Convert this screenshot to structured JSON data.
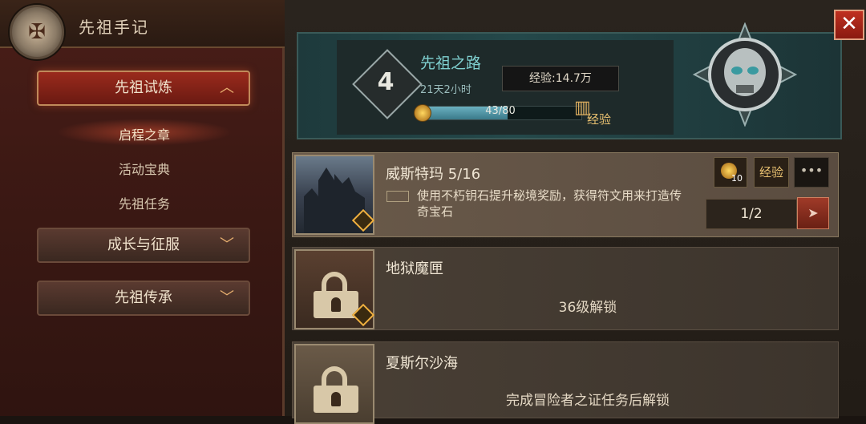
{
  "header": {
    "title": "先祖手记",
    "crest_icon": "sigil-icon"
  },
  "sidebar": {
    "menus": [
      {
        "label": "先祖试炼",
        "state": "expanded"
      },
      {
        "label": "成长与征服",
        "state": "collapsed"
      },
      {
        "label": "先祖传承",
        "state": "collapsed"
      }
    ],
    "sub_items": [
      "启程之章",
      "活动宝典",
      "先祖任务"
    ],
    "active_sub": "启程之章"
  },
  "banner": {
    "level": "4",
    "title": "先祖之路",
    "time_left": "21天2小时",
    "exp_total": "经验:14.7万",
    "exp_progress": "43/80",
    "exp_progress_fraction": 0.54,
    "exp_label": "经验"
  },
  "close": {
    "glyph": "✕"
  },
  "cards": [
    {
      "title": "威斯特玛 5/16",
      "description": "使用不朽钥石提升秘境奖励，获得符文用来打造传奇宝石",
      "key_count": "10",
      "exp_label": "经验",
      "more_label": "•••",
      "progress": "1/2",
      "go_icon": "➤"
    },
    {
      "title": "地狱魔匣",
      "unlock_text": "36级解锁"
    },
    {
      "title": "夏斯尔沙海",
      "unlock_text": "完成冒险者之证任务后解锁"
    }
  ],
  "colors": {
    "accent_red": "#9a2a1c",
    "teal": "#7fd0d0",
    "gold": "#e8c070"
  }
}
